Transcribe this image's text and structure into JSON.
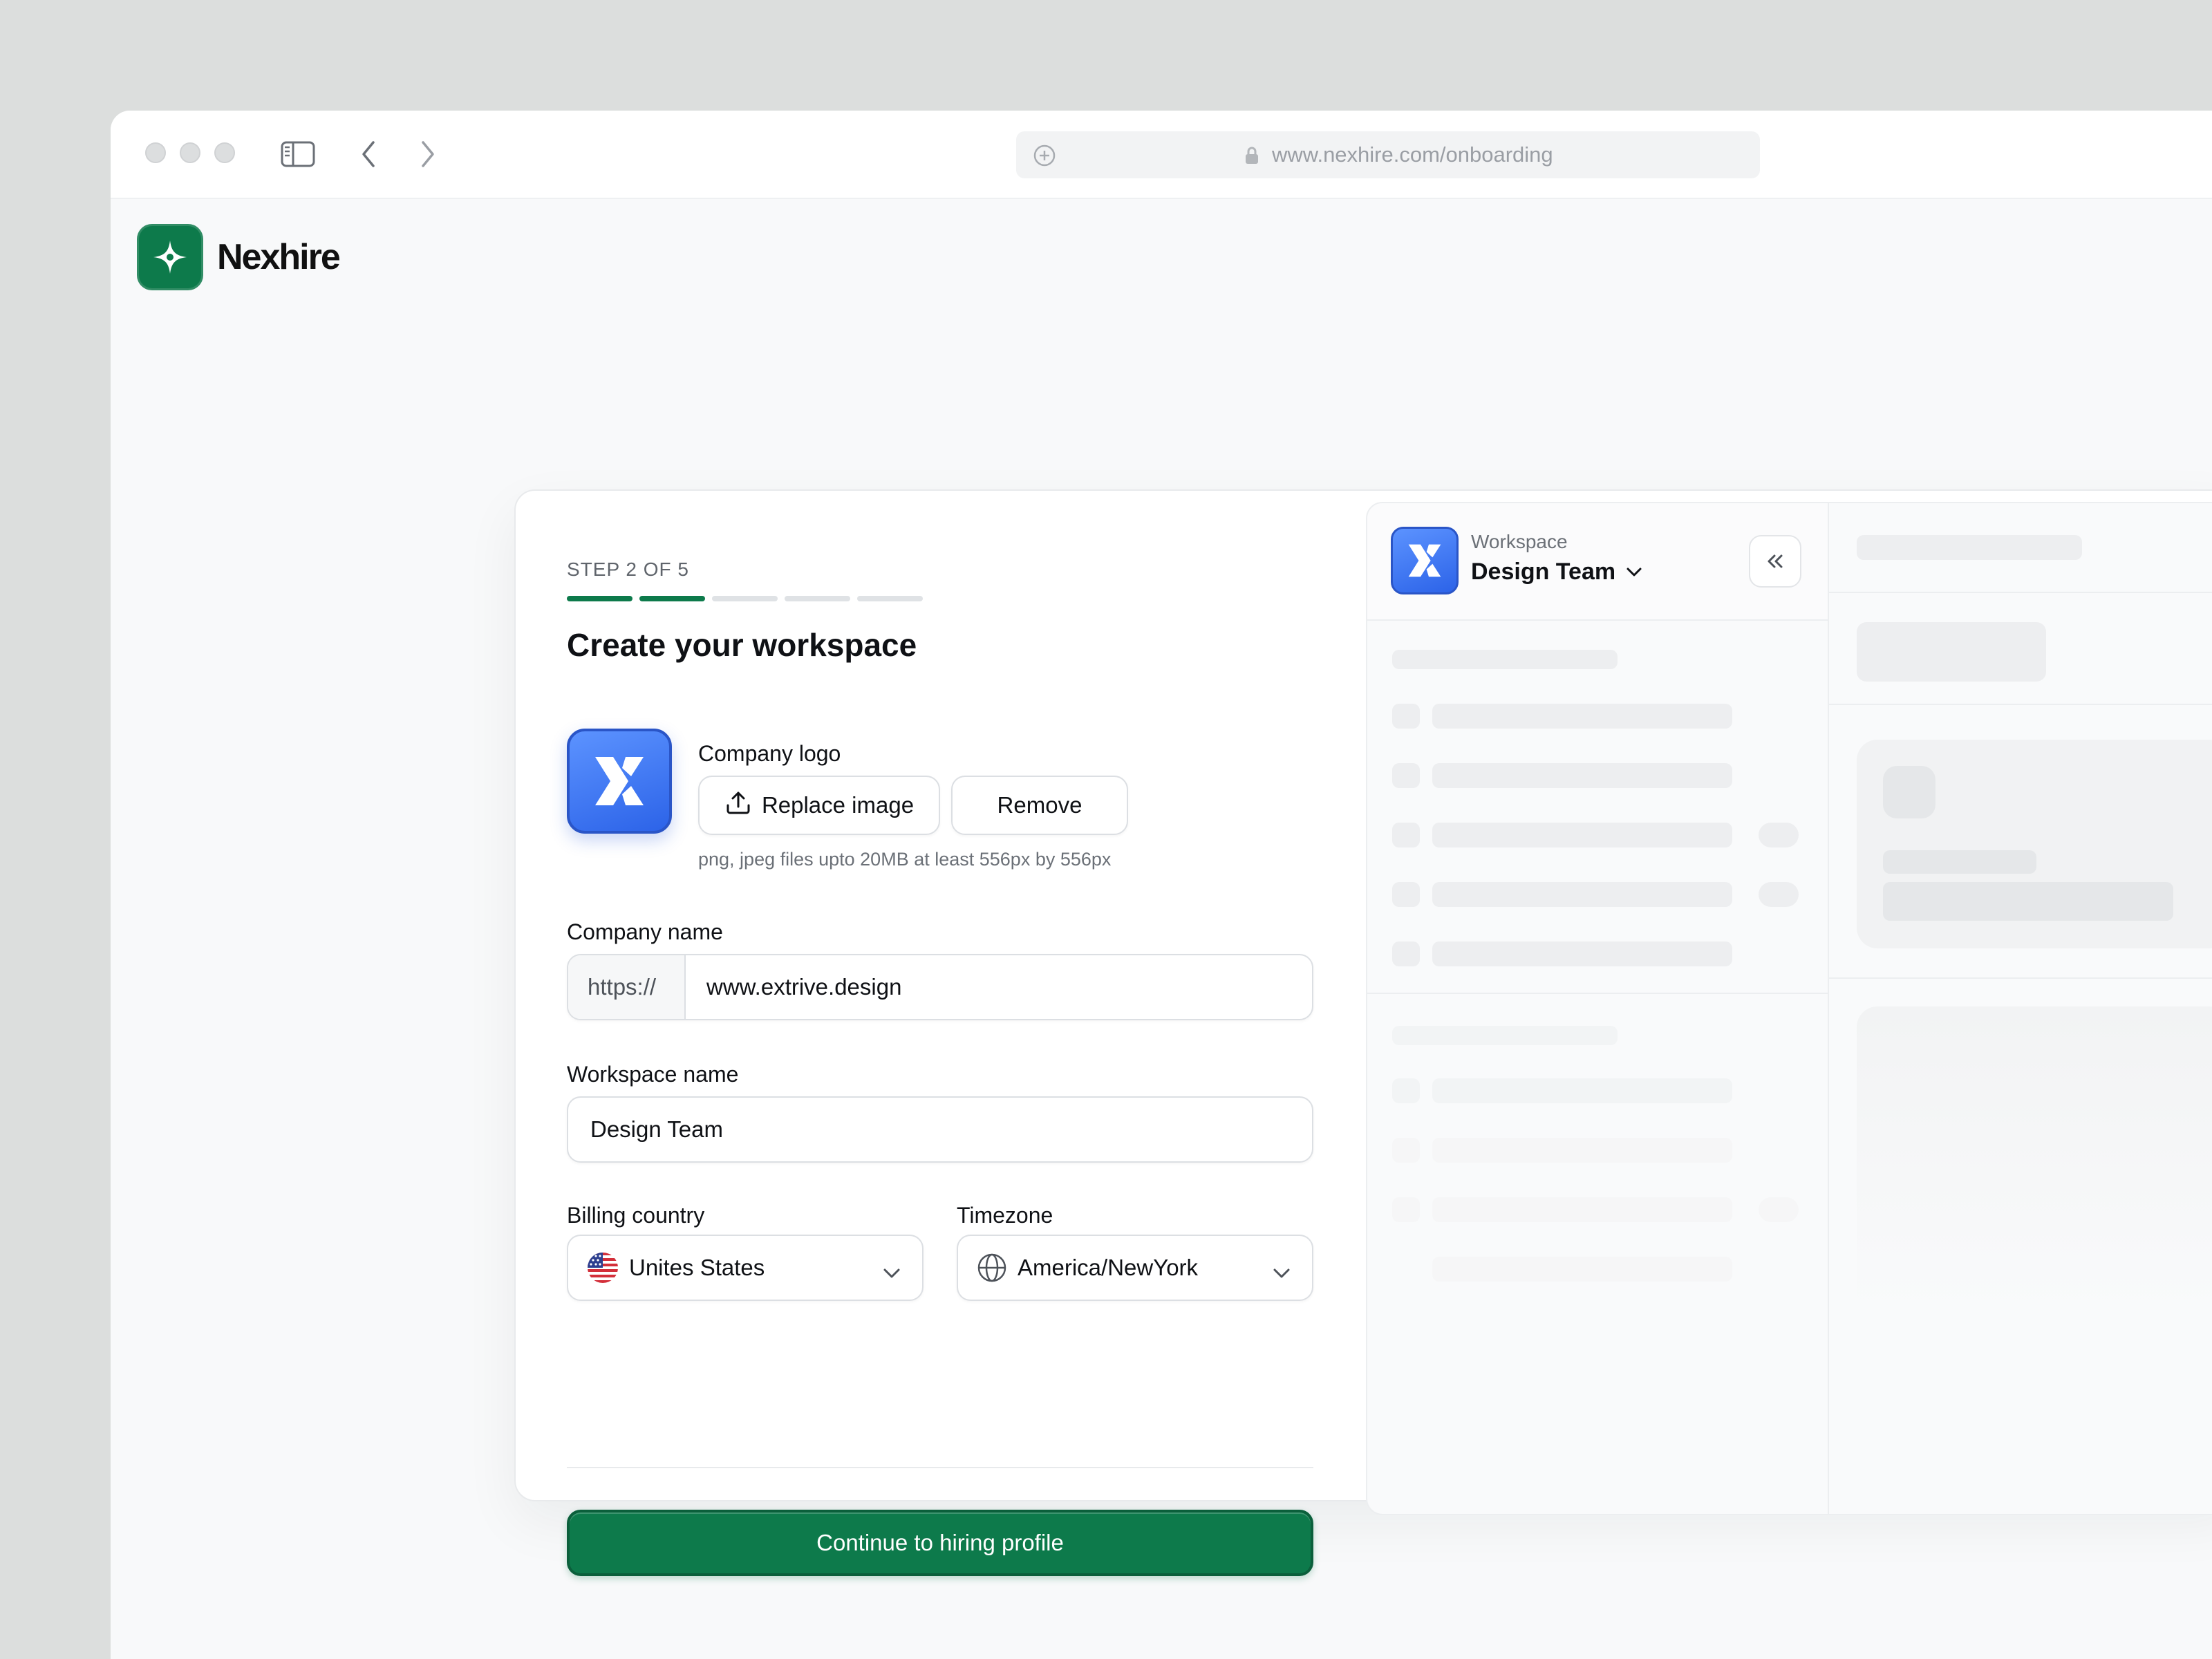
{
  "browser": {
    "url": "www.nexhire.com/onboarding"
  },
  "brand": {
    "name": "Nexhire",
    "color": "#0d7a4b"
  },
  "onboarding": {
    "step_label": "STEP 2 OF 5",
    "step_current": 2,
    "step_total": 5,
    "title": "Create your workspace",
    "company_logo": {
      "label": "Company logo",
      "replace_label": "Replace image",
      "remove_label": "Remove",
      "hint": "png, jpeg files upto 20MB at least 556px by 556px"
    },
    "company_name": {
      "label": "Company name",
      "prefix": "https://",
      "value": "www.extrive.design"
    },
    "workspace_name": {
      "label": "Workspace name",
      "value": "Design Team"
    },
    "billing_country": {
      "label": "Billing country",
      "value": "Unites States"
    },
    "timezone": {
      "label": "Timezone",
      "value": "America/NewYork"
    },
    "continue_label": "Continue to hiring profile"
  },
  "preview": {
    "workspace_label": "Workspace",
    "workspace_name": "Design Team"
  },
  "icons": {
    "sidebar_toggle": "sidebar-icon",
    "back": "chevron-left-icon",
    "forward": "chevron-right-icon",
    "new_tab": "plus-circle-icon",
    "lock": "lock-icon",
    "upload": "upload-icon",
    "flag": "us-flag-icon",
    "globe": "globe-icon",
    "chevron": "chevron-down-icon",
    "collapse": "double-chevron-left-icon"
  }
}
